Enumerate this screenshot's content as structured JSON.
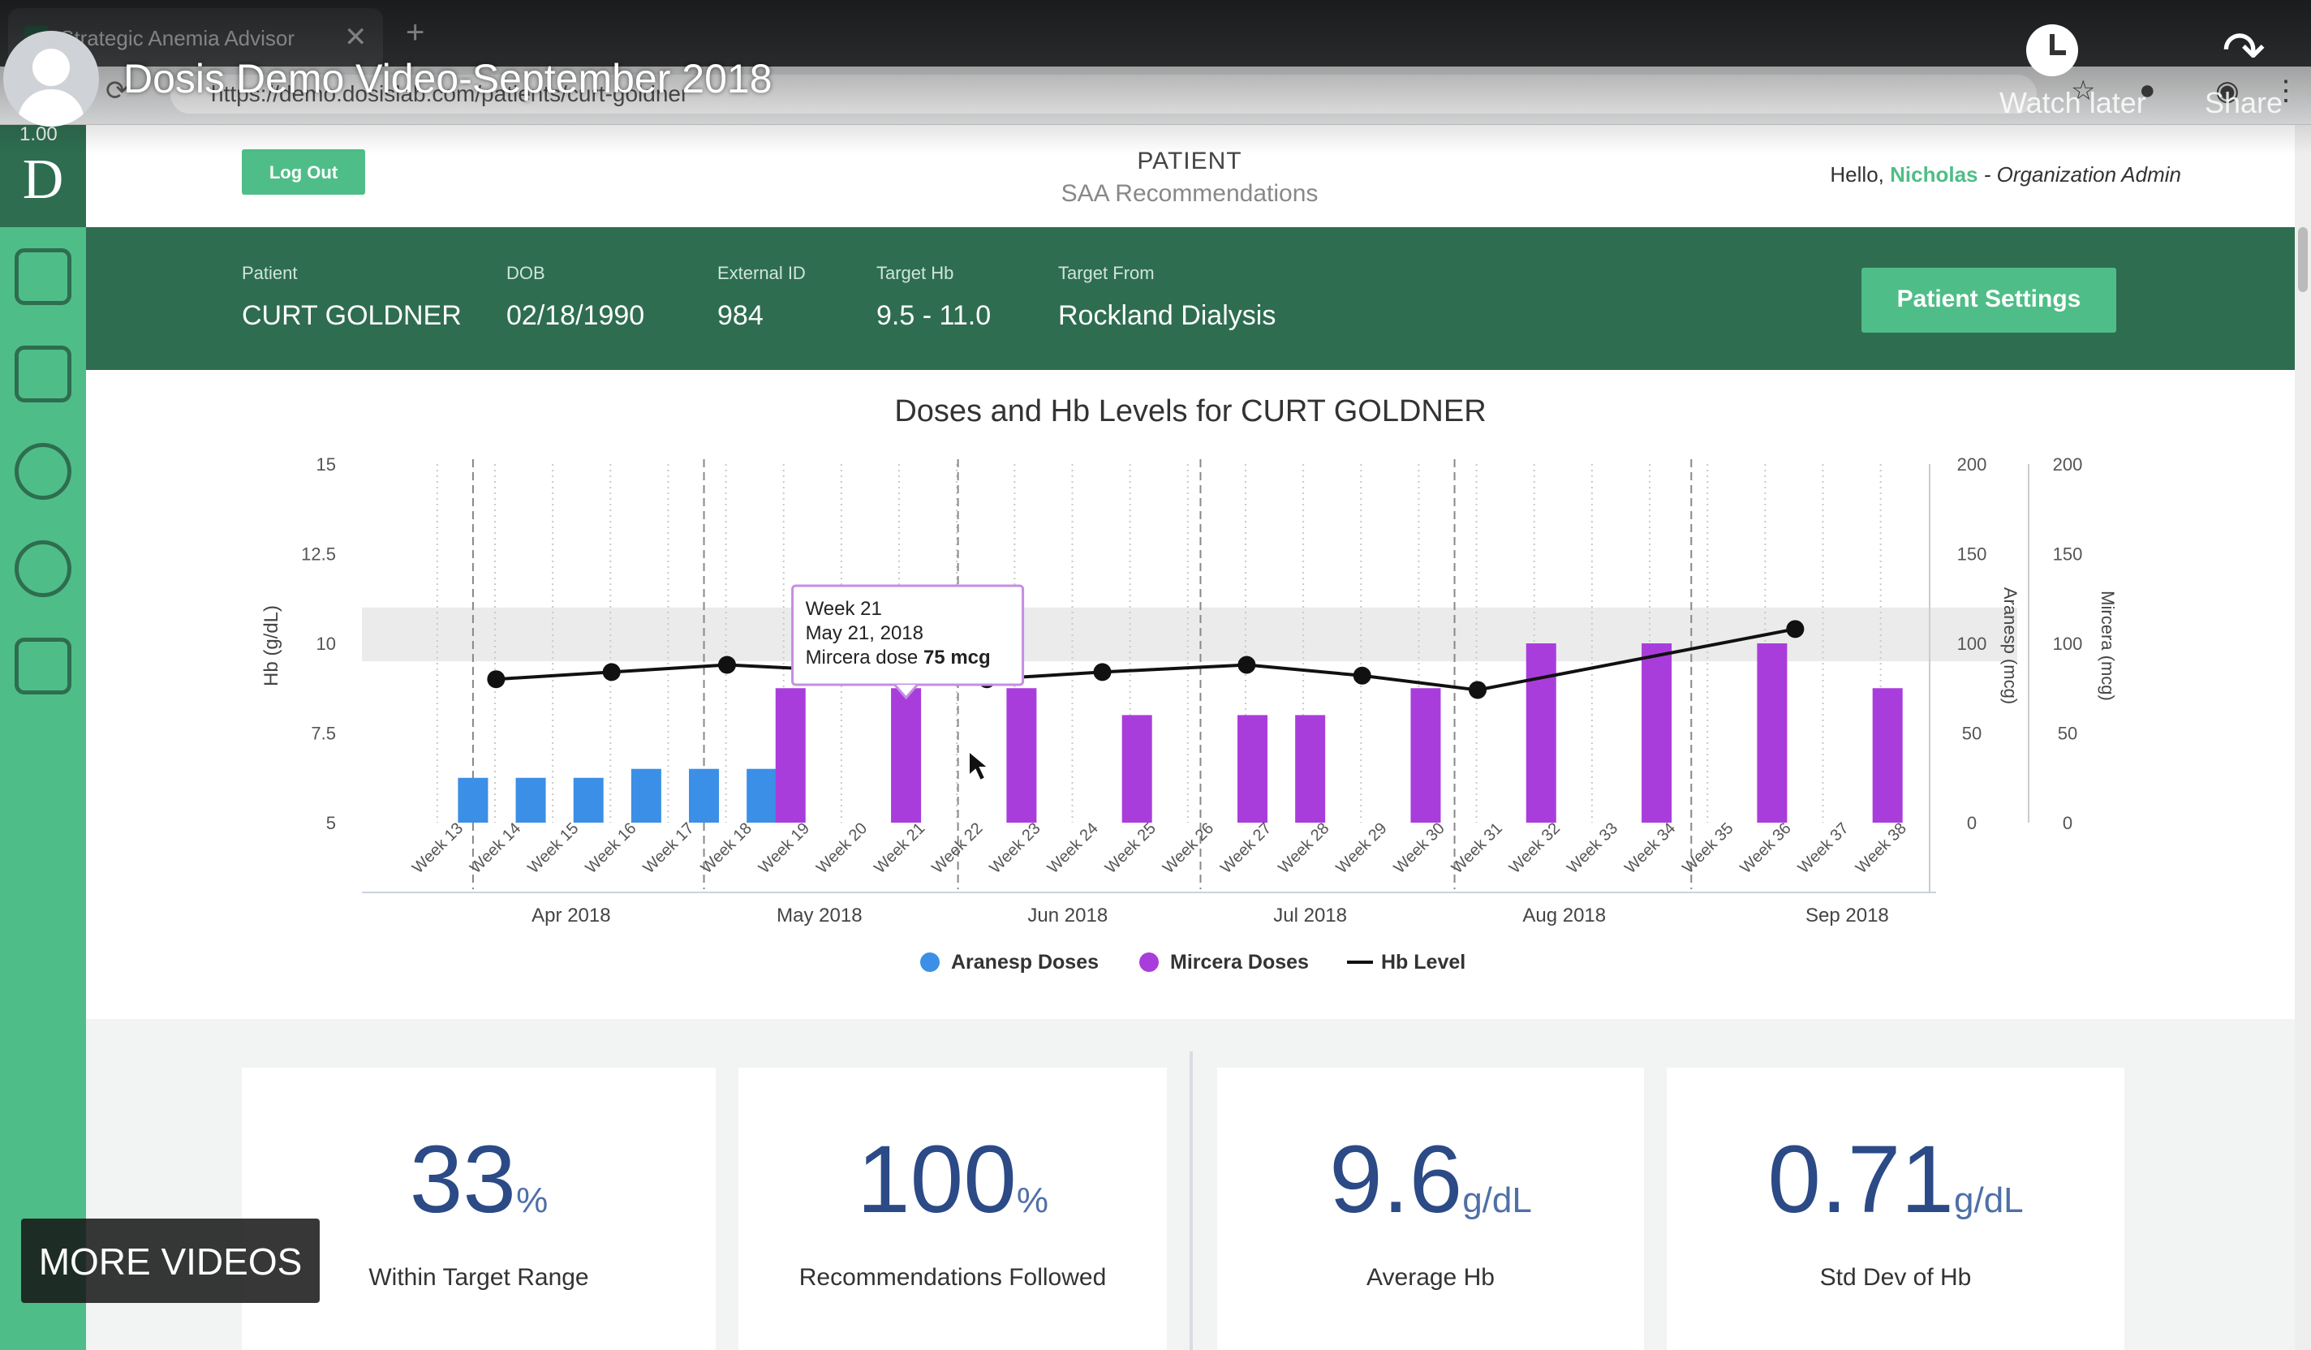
{
  "browser": {
    "tab_title": "Strategic Anemia Advisor",
    "url": "https://demo.dosislab.com/patients/curt-goldner"
  },
  "video": {
    "title": "Dosis Demo Video-September 2018",
    "speed": "1.00",
    "watch_later": "Watch later",
    "share": "Share",
    "more_videos": "MORE VIDEOS"
  },
  "sidebar": {
    "brand": "D",
    "items": [
      "hospital-icon",
      "clipboard-icon",
      "user-circle-icon",
      "saa-cycle-icon",
      "list-back-icon"
    ]
  },
  "header": {
    "logout": "Log Out",
    "title": "PATIENT",
    "subtitle": "SAA Recommendations",
    "hello": "Hello,",
    "user": "Nicholas",
    "role": "- Organization Admin"
  },
  "patient": {
    "fields": [
      {
        "label": "Patient",
        "value": "CURT GOLDNER"
      },
      {
        "label": "DOB",
        "value": "02/18/1990"
      },
      {
        "label": "External ID",
        "value": "984"
      },
      {
        "label": "Target Hb",
        "value": "9.5 - 11.0"
      },
      {
        "label": "Target From",
        "value": "Rockland Dialysis"
      }
    ],
    "settings_button": "Patient Settings"
  },
  "chart_data": {
    "type": "bar",
    "title": "Doses and Hb Levels for CURT GOLDNER",
    "ylabel_left": "Hb (g/dL)",
    "ylabel_right1": "Aranesp (mcg)",
    "ylabel_right2": "Mircera (mcg)",
    "ylim_left": [
      5,
      15
    ],
    "yticks_left": [
      "5",
      "7.5",
      "10",
      "12.5",
      "15"
    ],
    "ylim_right": [
      0,
      200
    ],
    "yticks_right": [
      "0",
      "50",
      "100",
      "150",
      "200"
    ],
    "target_band": [
      9.5,
      11
    ],
    "weeks": [
      "Week 13",
      "Week 14",
      "Week 15",
      "Week 16",
      "Week 17",
      "Week 18",
      "Week 19",
      "Week 20",
      "Week 21",
      "Week 22",
      "Week 23",
      "Week 24",
      "Week 25",
      "Week 26",
      "Week 27",
      "Week 28",
      "Week 29",
      "Week 30",
      "Week 31",
      "Week 32",
      "Week 33",
      "Week 34",
      "Week 35",
      "Week 36",
      "Week 37",
      "Week 38"
    ],
    "months": [
      "Apr 2018",
      "May 2018",
      "Jun 2018",
      "Jul 2018",
      "Aug 2018",
      "Sep 2018"
    ],
    "aranesp": [
      {
        "x": 0.3,
        "value": 25
      },
      {
        "x": 1.3,
        "value": 25
      },
      {
        "x": 2.3,
        "value": 25
      },
      {
        "x": 3.3,
        "value": 30
      },
      {
        "x": 4.3,
        "value": 30
      },
      {
        "x": 5.3,
        "value": 30
      }
    ],
    "mircera": [
      {
        "x": 5.8,
        "value": 75
      },
      {
        "x": 7.8,
        "value": 75
      },
      {
        "x": 9.8,
        "value": 75
      },
      {
        "x": 11.8,
        "value": 60
      },
      {
        "x": 13.8,
        "value": 60
      },
      {
        "x": 14.8,
        "value": 60
      },
      {
        "x": 16.8,
        "value": 75
      },
      {
        "x": 18.8,
        "value": 100
      },
      {
        "x": 20.8,
        "value": 100
      },
      {
        "x": 22.8,
        "value": 100
      },
      {
        "x": 24.8,
        "value": 75
      }
    ],
    "hb_level": [
      {
        "x": 0.7,
        "y": 9.0
      },
      {
        "x": 2.7,
        "y": 9.2
      },
      {
        "x": 4.7,
        "y": 9.4
      },
      {
        "x": 7.2,
        "y": 9.2
      },
      {
        "x": 9.2,
        "y": 9.0
      },
      {
        "x": 11.2,
        "y": 9.2
      },
      {
        "x": 13.7,
        "y": 9.4
      },
      {
        "x": 15.7,
        "y": 9.1
      },
      {
        "x": 17.7,
        "y": 8.7
      },
      {
        "x": 23.2,
        "y": 10.4
      }
    ],
    "legend": [
      "Aranesp Doses",
      "Mircera Doses",
      "Hb Level"
    ],
    "series_colors": {
      "aranesp": "#3b8fe6",
      "mircera": "#a93ddb",
      "hb": "#111111"
    },
    "tooltip": {
      "line1": "Week 21",
      "line2": "May 21, 2018",
      "line3_prefix": "Mircera dose",
      "line3_value": "75 mcg",
      "x": 7.8
    }
  },
  "stats": [
    {
      "value": "33",
      "unit": "%",
      "label": "Within Target Range"
    },
    {
      "value": "100",
      "unit": "%",
      "label": "Recommendations Followed"
    },
    {
      "value": "9.6",
      "unit": "g/dL",
      "label": "Average Hb"
    },
    {
      "value": "0.71",
      "unit": "g/dL",
      "label": "Std Dev of Hb"
    }
  ]
}
